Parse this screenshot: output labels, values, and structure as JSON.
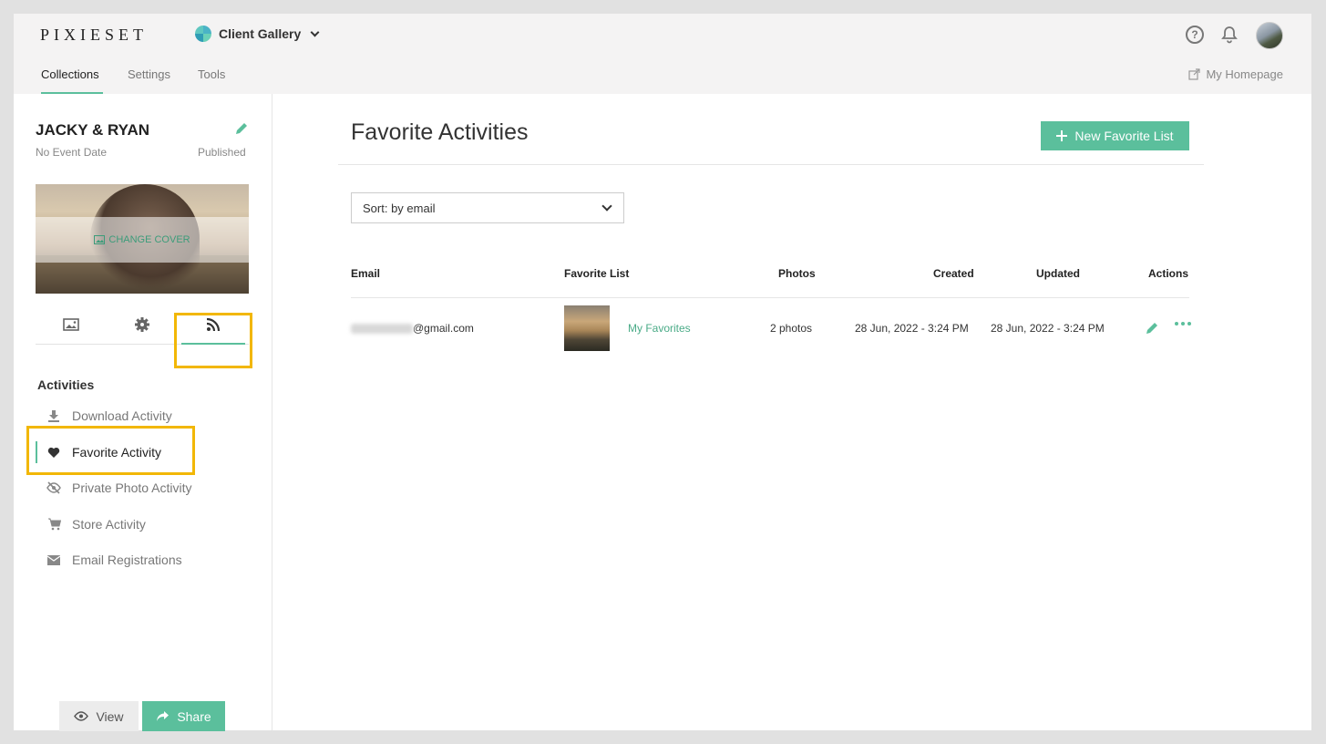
{
  "header": {
    "logo": "PIXIESET",
    "app_name": "Client Gallery",
    "help_label": "?"
  },
  "nav": {
    "tabs": [
      {
        "label": "Collections",
        "active": true
      },
      {
        "label": "Settings",
        "active": false
      },
      {
        "label": "Tools",
        "active": false
      }
    ],
    "homepage_label": "My Homepage"
  },
  "sidebar": {
    "collection_title": "JACKY & RYAN",
    "event_date": "No Event Date",
    "status": "Published",
    "change_cover_label": "CHANGE COVER",
    "section_label": "Activities",
    "activities": [
      {
        "label": "Download Activity",
        "icon": "download-icon"
      },
      {
        "label": "Favorite Activity",
        "icon": "heart-icon",
        "active": true
      },
      {
        "label": "Private Photo Activity",
        "icon": "eye-slash-icon"
      },
      {
        "label": "Store Activity",
        "icon": "cart-icon"
      },
      {
        "label": "Email Registrations",
        "icon": "envelope-icon"
      }
    ],
    "view_label": "View",
    "share_label": "Share"
  },
  "main": {
    "title": "Favorite Activities",
    "new_button_label": "New Favorite List",
    "sort_label": "Sort: by email",
    "columns": {
      "email": "Email",
      "favorite_list": "Favorite List",
      "photos": "Photos",
      "created": "Created",
      "updated": "Updated",
      "actions": "Actions"
    },
    "rows": [
      {
        "email_domain": "@gmail.com",
        "list_name": "My Favorites",
        "photos": "2 photos",
        "created": "28 Jun, 2022 - 3:24 PM",
        "updated": "28 Jun, 2022 - 3:24 PM"
      }
    ]
  },
  "colors": {
    "accent": "#5bbf9c",
    "highlight": "#f2b705"
  }
}
